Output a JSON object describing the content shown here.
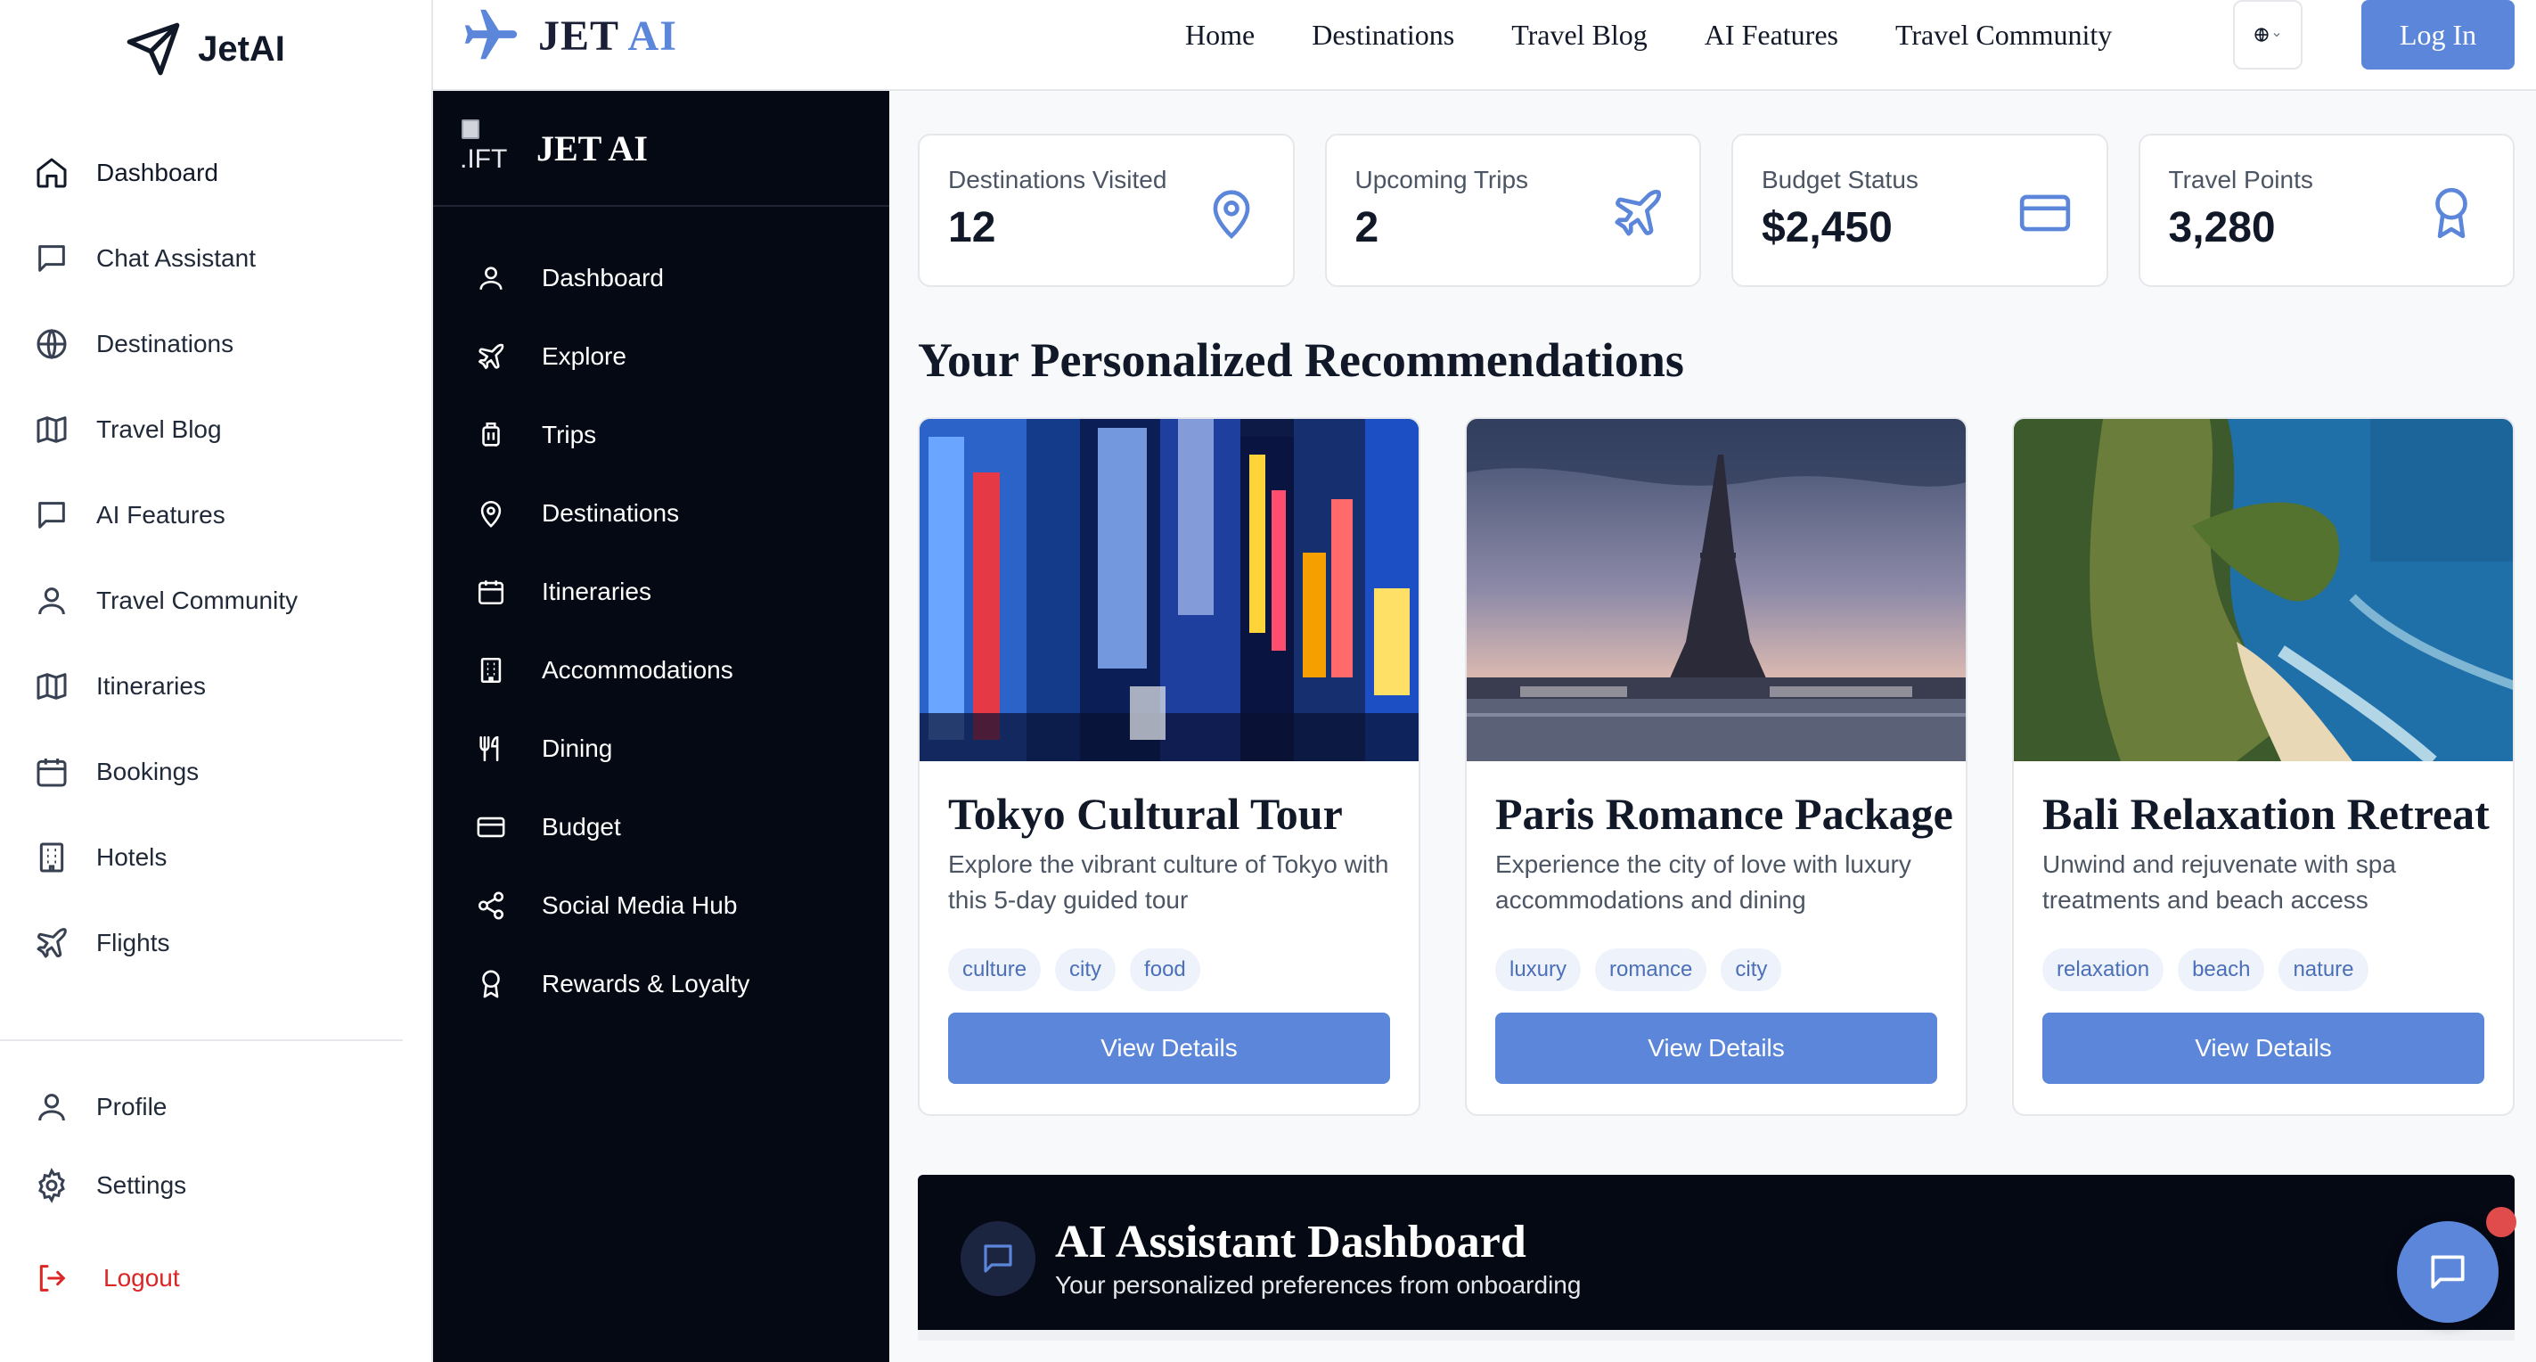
{
  "colors": {
    "accent": "#5b86d9",
    "dark": "#050914",
    "danger": "#dc2626",
    "notification": "#e04b4b"
  },
  "sidebar": {
    "brand": "JetAI",
    "brand_icon": "send-icon",
    "items": [
      {
        "label": "Dashboard",
        "icon": "home-icon"
      },
      {
        "label": "Chat Assistant",
        "icon": "chat-icon"
      },
      {
        "label": "Destinations",
        "icon": "globe-icon"
      },
      {
        "label": "Travel Blog",
        "icon": "map-icon"
      },
      {
        "label": "AI Features",
        "icon": "chat-icon"
      },
      {
        "label": "Travel Community",
        "icon": "user-icon"
      },
      {
        "label": "Itineraries",
        "icon": "map-icon"
      },
      {
        "label": "Bookings",
        "icon": "calendar-icon"
      },
      {
        "label": "Hotels",
        "icon": "building-icon"
      },
      {
        "label": "Flights",
        "icon": "plane-icon"
      }
    ],
    "bottom": [
      {
        "label": "Profile",
        "icon": "user-icon"
      },
      {
        "label": "Settings",
        "icon": "gear-icon"
      },
      {
        "label": "Logout",
        "icon": "logout-icon"
      }
    ]
  },
  "topbar": {
    "logo_jet": "JET",
    "logo_ai": "AI",
    "links": [
      "Home",
      "Destinations",
      "Travel Blog",
      "AI Features",
      "Travel Community"
    ],
    "language_icon": "globe-icon",
    "login": "Log In"
  },
  "dark_sidebar": {
    "logo_alt": ".IFT",
    "title": "JET AI",
    "items": [
      {
        "label": "Dashboard",
        "icon": "user-icon"
      },
      {
        "label": "Explore",
        "icon": "plane-icon"
      },
      {
        "label": "Trips",
        "icon": "luggage-icon"
      },
      {
        "label": "Destinations",
        "icon": "pin-icon"
      },
      {
        "label": "Itineraries",
        "icon": "calendar-icon"
      },
      {
        "label": "Accommodations",
        "icon": "building-icon"
      },
      {
        "label": "Dining",
        "icon": "utensils-icon"
      },
      {
        "label": "Budget",
        "icon": "card-icon"
      },
      {
        "label": "Social Media Hub",
        "icon": "share-icon"
      },
      {
        "label": "Rewards & Loyalty",
        "icon": "award-icon"
      }
    ]
  },
  "stats": [
    {
      "label": "Destinations Visited",
      "value": "12",
      "icon": "pin-icon"
    },
    {
      "label": "Upcoming Trips",
      "value": "2",
      "icon": "plane-icon"
    },
    {
      "label": "Budget Status",
      "value": "$2,450",
      "icon": "card-icon"
    },
    {
      "label": "Travel Points",
      "value": "3,280",
      "icon": "award-icon"
    }
  ],
  "recommendations": {
    "title": "Your Personalized Recommendations",
    "cards": [
      {
        "title": "Tokyo Cultural Tour",
        "description": "Explore the vibrant culture of Tokyo with this 5-day guided tour",
        "tags": [
          "culture",
          "city",
          "food"
        ],
        "button": "View Details",
        "image": "tokyo-photo"
      },
      {
        "title": "Paris Romance Package",
        "description": "Experience the city of love with luxury accommodations and dining",
        "tags": [
          "luxury",
          "romance",
          "city"
        ],
        "button": "View Details",
        "image": "paris-photo"
      },
      {
        "title": "Bali Relaxation Retreat",
        "description": "Unwind and rejuvenate with spa treatments and beach access",
        "tags": [
          "relaxation",
          "beach",
          "nature"
        ],
        "button": "View Details",
        "image": "bali-photo"
      }
    ]
  },
  "ai_panel": {
    "title": "AI Assistant Dashboard",
    "subtitle": "Your personalized preferences from onboarding",
    "icon": "chat-icon"
  },
  "chat_fab": {
    "icon": "chat-icon"
  }
}
